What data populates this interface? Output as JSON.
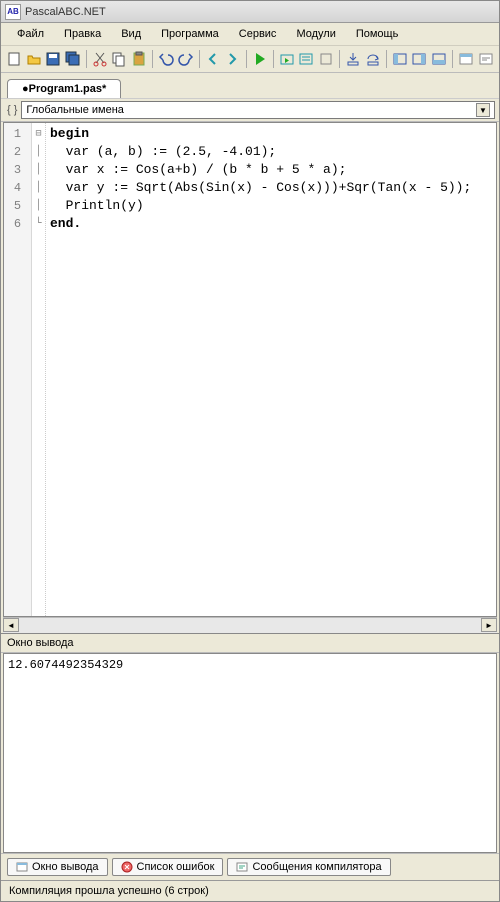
{
  "title": "PascalABC.NET",
  "menu": [
    "Файл",
    "Правка",
    "Вид",
    "Программа",
    "Сервис",
    "Модули",
    "Помощь"
  ],
  "tab": "●Program1.pas*",
  "dropdown": "Глобальные имена",
  "code": {
    "lines": [
      {
        "n": "1",
        "fold": "⊟",
        "t": "begin"
      },
      {
        "n": "2",
        "fold": "",
        "t": "  var (a, b) := (2.5, -4.01);"
      },
      {
        "n": "3",
        "fold": "",
        "t": "  var x := Cos(a+b) / (b * b + 5 * a);"
      },
      {
        "n": "4",
        "fold": "",
        "t": "  var y := Sqrt(Abs(Sin(x) - Cos(x)))+Sqr(Tan(x - 5));"
      },
      {
        "n": "5",
        "fold": "",
        "t": "  Println(y)"
      },
      {
        "n": "6",
        "fold": "",
        "t": "end."
      }
    ]
  },
  "output_header": "Окно вывода",
  "output_text": "12.6074492354329",
  "bottom_tabs": {
    "output": "Окно вывода",
    "errors": "Список ошибок",
    "compiler": "Сообщения компилятора"
  },
  "status": "Компиляция прошла успешно (6 строк)"
}
